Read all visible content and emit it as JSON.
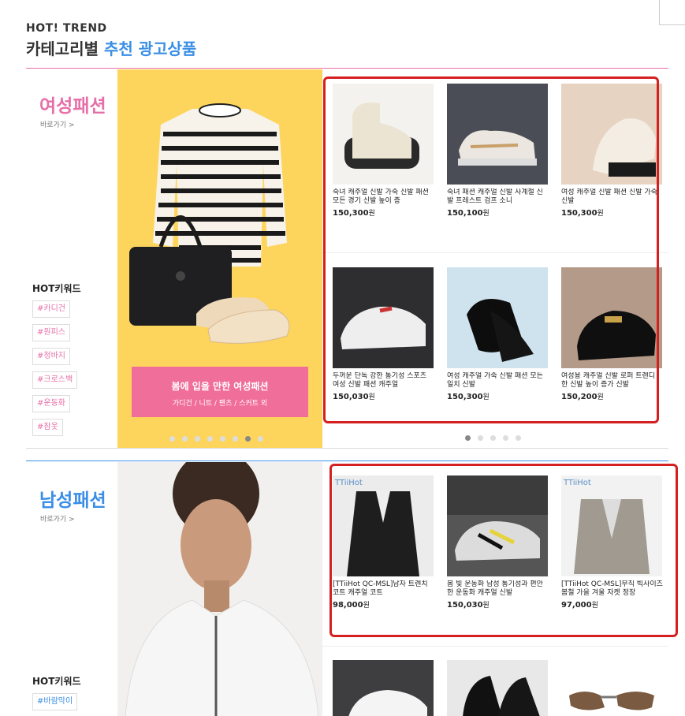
{
  "header": {
    "small": "HOT! TREND",
    "big_prefix": "카테고리별 ",
    "big_highlight": "추천 광고상품"
  },
  "women": {
    "title": "여성패션",
    "go": "바로가기 >",
    "kw_label": "HOT키워드",
    "keywords": [
      "#카디건",
      "#원피스",
      "#청바지",
      "#크로스백",
      "#운동화",
      "#잠옷"
    ],
    "banner_title": "봄에 입을 만한 여성패션",
    "banner_sub": "가디건 / 니트 / 팬츠 / 스커트 외",
    "products": [
      {
        "title": "숙녀 캐주얼 신발 가죽 신발 패션 모든 경기 신발 높이 증",
        "price": "150,300",
        "unit": "원"
      },
      {
        "title": "숙녀 패션 캐주얼 신발 사계절 신발 프레스트 검프 소니",
        "price": "150,100",
        "unit": "원"
      },
      {
        "title": "여성 캐주얼 신발 패션 신발 가죽 신발",
        "price": "150,300",
        "unit": "원"
      },
      {
        "title": "두꺼운 단독 강한 통기성 스포츠 여성 신발 패션 캐주얼",
        "price": "150,030",
        "unit": "원"
      },
      {
        "title": "여성 캐주얼 가죽 신발 패션 모든 일치 신발",
        "price": "150,300",
        "unit": "원"
      },
      {
        "title": "여성용 캐주얼 신발 로퍼 트렌디 한 신발 높이 증가 신발",
        "price": "150,200",
        "unit": "원"
      }
    ]
  },
  "men": {
    "title": "남성패션",
    "go": "바로가기 >",
    "kw_label": "HOT키워드",
    "keywords": [
      "#바람막이"
    ],
    "products": [
      {
        "title": "[TTiiHot QC-MSL]남자 트렌치 코트 캐주얼 코트",
        "price": "98,000",
        "unit": "원"
      },
      {
        "title": "봄 빛 운동화 남성 통기성과 편안한 운동화 캐주얼 신발",
        "price": "150,030",
        "unit": "원"
      },
      {
        "title": "[TTiiHot QC-MSL]무직 빅사이즈 봄철 가을 겨울 자켓 정장",
        "price": "97,000",
        "unit": "원"
      }
    ],
    "brand_tag": "TTiiHot"
  },
  "colors": {
    "women_accent": "#e76fa8",
    "men_accent": "#3a8ee6",
    "annotation": "#d42020"
  }
}
